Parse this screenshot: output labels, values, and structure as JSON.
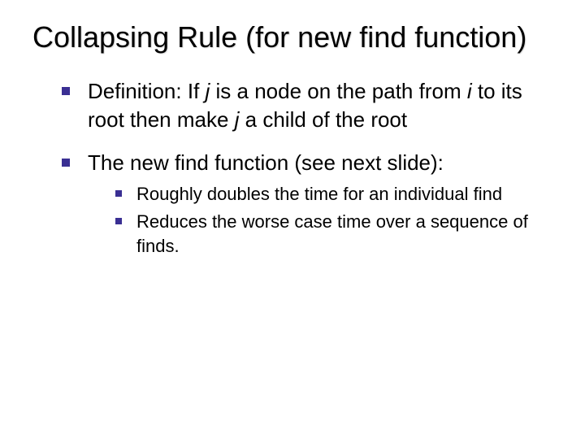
{
  "title": "Collapsing Rule (for new find function)",
  "bullets": {
    "b1_pre": "Definition: If ",
    "b1_j1": "j",
    "b1_mid1": " is a node on the path from ",
    "b1_i": "i",
    "b1_mid2": " to its root then make ",
    "b1_j2": "j",
    "b1_post": " a child of the root",
    "b2": "The new find function (see next slide):",
    "sub1": "Roughly doubles the time for an individual find",
    "sub2": "Reduces the worse case time over a sequence of finds."
  }
}
